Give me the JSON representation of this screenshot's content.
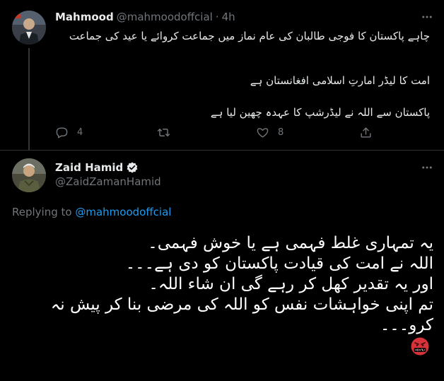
{
  "parent_tweet": {
    "author_name": "Mahmood",
    "author_handle": "@mahmoodoffcial",
    "separator_dot": "·",
    "time": "4h",
    "text_line1": "چاہے پاکستان کا فوجی طالبان کی عام نماز میں جماعت کروائے یا عید کی جماعت",
    "text_line2": "امت کا لیڈر امارتِ اسلامی افغانستان ہے",
    "text_line3": "پاکستان سے اللہ نے لیڈرشپ کا عہدہ چھین لیا ہے",
    "reply_count": "4",
    "retweet_count": "",
    "like_count": "8",
    "icons": [
      "reply-icon",
      "retweet-icon",
      "like-icon",
      "share-icon",
      "more-icon"
    ]
  },
  "reply_tweet": {
    "author_name": "Zaid Hamid",
    "author_handle": "@ZaidZamanHamid",
    "verified": true,
    "replying_label": "Replying to",
    "replying_to": "@mahmoodoffcial",
    "lines": [
      "یہ تمہاری غلط فہمی ہے یا خوش فہمی۔",
      "اللہ نے امت کی قیادت پاکستان کو دی ہے۔۔۔",
      "اور یہ تقدیر کھل کر رہے گی ان شاء اللہ۔",
      "تم اپنی خواہشات نفس کو اللہ کی مرضی بنا کر پیش نہ",
      "کرو۔۔۔"
    ],
    "emoji": "angry-face-symbols-emoji",
    "icons": [
      "verified-badge-icon",
      "more-icon"
    ]
  },
  "colors": {
    "background": "#000000",
    "text": "#e7e9ea",
    "secondary": "#71767b",
    "accent": "#1d9bf0",
    "divider": "#2f3336"
  }
}
